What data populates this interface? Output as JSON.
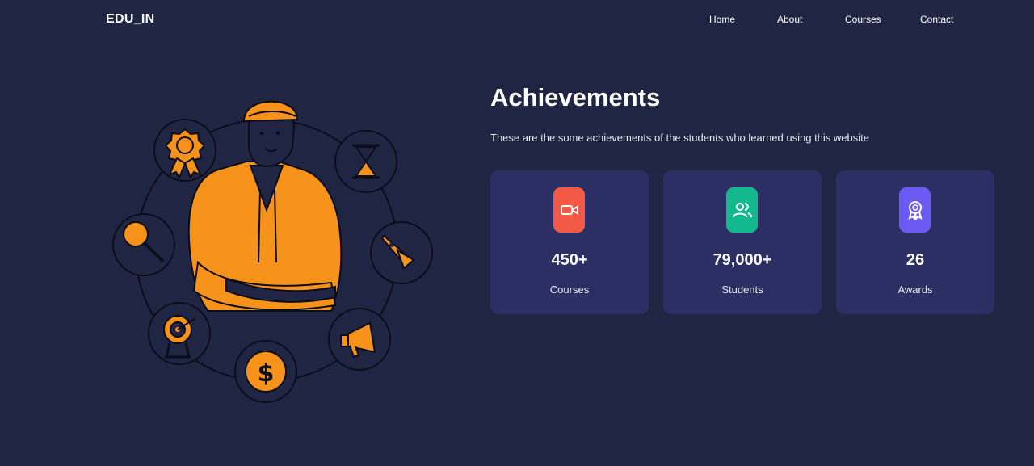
{
  "brand": "EDU_IN",
  "nav": {
    "items": [
      "Home",
      "About",
      "Courses",
      "Contact"
    ]
  },
  "hero": {
    "title": "Achievements",
    "subtitle": "These are the some achievements of the students who learned using this website"
  },
  "stats": [
    {
      "value": "450+",
      "label": "Courses",
      "icon": "video-camera-icon",
      "color": "#f25a45"
    },
    {
      "value": "79,000+",
      "label": "Students",
      "icon": "users-icon",
      "color": "#14b88e"
    },
    {
      "value": "26",
      "label": "Awards",
      "icon": "award-ribbon-icon",
      "color": "#6c5bf2"
    }
  ],
  "theme": {
    "background": "#1f2542",
    "card": "#2c2f63",
    "accent": "#f7931a"
  }
}
